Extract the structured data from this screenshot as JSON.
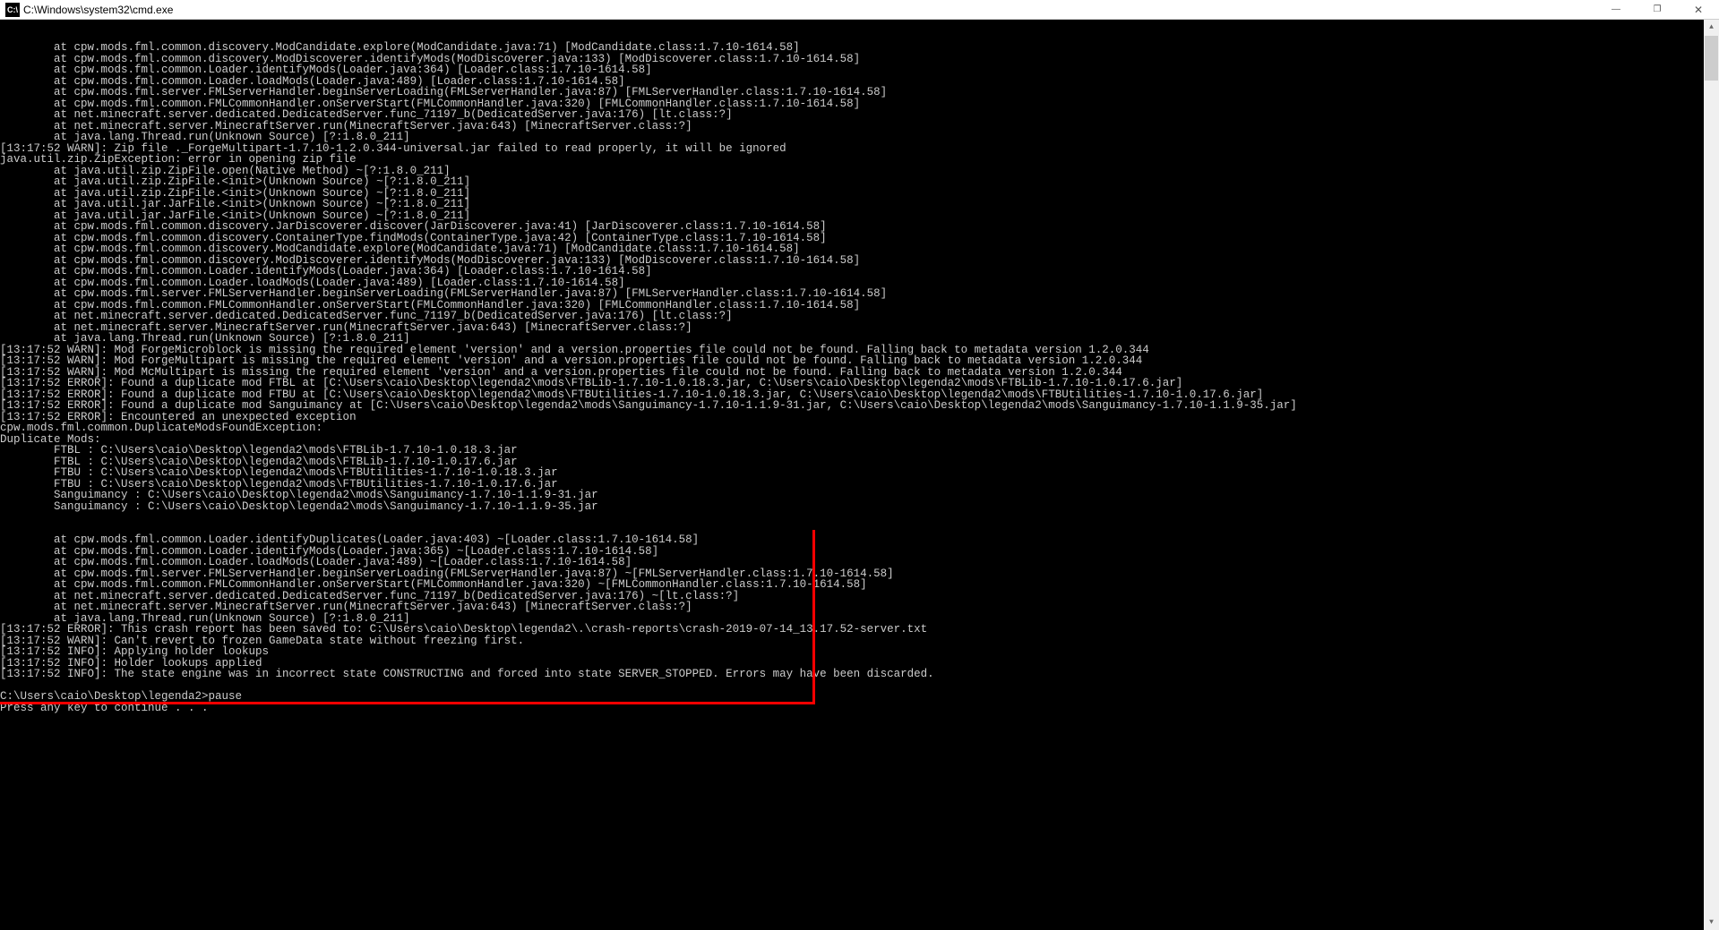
{
  "window": {
    "title": "C:\\Windows\\system32\\cmd.exe",
    "icon_label": "cmd-icon",
    "minimize": "—",
    "maximize": "❐",
    "close": "✕"
  },
  "terminal_lines": [
    "        at cpw.mods.fml.common.discovery.ModCandidate.explore(ModCandidate.java:71) [ModCandidate.class:1.7.10-1614.58]",
    "        at cpw.mods.fml.common.discovery.ModDiscoverer.identifyMods(ModDiscoverer.java:133) [ModDiscoverer.class:1.7.10-1614.58]",
    "        at cpw.mods.fml.common.Loader.identifyMods(Loader.java:364) [Loader.class:1.7.10-1614.58]",
    "        at cpw.mods.fml.common.Loader.loadMods(Loader.java:489) [Loader.class:1.7.10-1614.58]",
    "        at cpw.mods.fml.server.FMLServerHandler.beginServerLoading(FMLServerHandler.java:87) [FMLServerHandler.class:1.7.10-1614.58]",
    "        at cpw.mods.fml.common.FMLCommonHandler.onServerStart(FMLCommonHandler.java:320) [FMLCommonHandler.class:1.7.10-1614.58]",
    "        at net.minecraft.server.dedicated.DedicatedServer.func_71197_b(DedicatedServer.java:176) [lt.class:?]",
    "        at net.minecraft.server.MinecraftServer.run(MinecraftServer.java:643) [MinecraftServer.class:?]",
    "        at java.lang.Thread.run(Unknown Source) [?:1.8.0_211]",
    "[13:17:52 WARN]: Zip file ._ForgeMultipart-1.7.10-1.2.0.344-universal.jar failed to read properly, it will be ignored",
    "java.util.zip.ZipException: error in opening zip file",
    "        at java.util.zip.ZipFile.open(Native Method) ~[?:1.8.0_211]",
    "        at java.util.zip.ZipFile.<init>(Unknown Source) ~[?:1.8.0_211]",
    "        at java.util.zip.ZipFile.<init>(Unknown Source) ~[?:1.8.0_211]",
    "        at java.util.jar.JarFile.<init>(Unknown Source) ~[?:1.8.0_211]",
    "        at java.util.jar.JarFile.<init>(Unknown Source) ~[?:1.8.0_211]",
    "        at cpw.mods.fml.common.discovery.JarDiscoverer.discover(JarDiscoverer.java:41) [JarDiscoverer.class:1.7.10-1614.58]",
    "        at cpw.mods.fml.common.discovery.ContainerType.findMods(ContainerType.java:42) [ContainerType.class:1.7.10-1614.58]",
    "        at cpw.mods.fml.common.discovery.ModCandidate.explore(ModCandidate.java:71) [ModCandidate.class:1.7.10-1614.58]",
    "        at cpw.mods.fml.common.discovery.ModDiscoverer.identifyMods(ModDiscoverer.java:133) [ModDiscoverer.class:1.7.10-1614.58]",
    "        at cpw.mods.fml.common.Loader.identifyMods(Loader.java:364) [Loader.class:1.7.10-1614.58]",
    "        at cpw.mods.fml.common.Loader.loadMods(Loader.java:489) [Loader.class:1.7.10-1614.58]",
    "        at cpw.mods.fml.server.FMLServerHandler.beginServerLoading(FMLServerHandler.java:87) [FMLServerHandler.class:1.7.10-1614.58]",
    "        at cpw.mods.fml.common.FMLCommonHandler.onServerStart(FMLCommonHandler.java:320) [FMLCommonHandler.class:1.7.10-1614.58]",
    "        at net.minecraft.server.dedicated.DedicatedServer.func_71197_b(DedicatedServer.java:176) [lt.class:?]",
    "        at net.minecraft.server.MinecraftServer.run(MinecraftServer.java:643) [MinecraftServer.class:?]",
    "        at java.lang.Thread.run(Unknown Source) [?:1.8.0_211]",
    "[13:17:52 WARN]: Mod ForgeMicroblock is missing the required element 'version' and a version.properties file could not be found. Falling back to metadata version 1.2.0.344",
    "[13:17:52 WARN]: Mod ForgeMultipart is missing the required element 'version' and a version.properties file could not be found. Falling back to metadata version 1.2.0.344",
    "[13:17:52 WARN]: Mod McMultipart is missing the required element 'version' and a version.properties file could not be found. Falling back to metadata version 1.2.0.344",
    "[13:17:52 ERROR]: Found a duplicate mod FTBL at [C:\\Users\\caio\\Desktop\\legenda2\\mods\\FTBLib-1.7.10-1.0.18.3.jar, C:\\Users\\caio\\Desktop\\legenda2\\mods\\FTBLib-1.7.10-1.0.17.6.jar]",
    "[13:17:52 ERROR]: Found a duplicate mod FTBU at [C:\\Users\\caio\\Desktop\\legenda2\\mods\\FTBUtilities-1.7.10-1.0.18.3.jar, C:\\Users\\caio\\Desktop\\legenda2\\mods\\FTBUtilities-1.7.10-1.0.17.6.jar]",
    "[13:17:52 ERROR]: Found a duplicate mod Sanguimancy at [C:\\Users\\caio\\Desktop\\legenda2\\mods\\Sanguimancy-1.7.10-1.1.9-31.jar, C:\\Users\\caio\\Desktop\\legenda2\\mods\\Sanguimancy-1.7.10-1.1.9-35.jar]",
    "[13:17:52 ERROR]: Encountered an unexpected exception",
    "cpw.mods.fml.common.DuplicateModsFoundException: ",
    "Duplicate Mods:",
    "        FTBL : C:\\Users\\caio\\Desktop\\legenda2\\mods\\FTBLib-1.7.10-1.0.18.3.jar",
    "        FTBL : C:\\Users\\caio\\Desktop\\legenda2\\mods\\FTBLib-1.7.10-1.0.17.6.jar",
    "        FTBU : C:\\Users\\caio\\Desktop\\legenda2\\mods\\FTBUtilities-1.7.10-1.0.18.3.jar",
    "        FTBU : C:\\Users\\caio\\Desktop\\legenda2\\mods\\FTBUtilities-1.7.10-1.0.17.6.jar",
    "        Sanguimancy : C:\\Users\\caio\\Desktop\\legenda2\\mods\\Sanguimancy-1.7.10-1.1.9-31.jar",
    "        Sanguimancy : C:\\Users\\caio\\Desktop\\legenda2\\mods\\Sanguimancy-1.7.10-1.1.9-35.jar",
    "",
    "",
    "        at cpw.mods.fml.common.Loader.identifyDuplicates(Loader.java:403) ~[Loader.class:1.7.10-1614.58]",
    "        at cpw.mods.fml.common.Loader.identifyMods(Loader.java:365) ~[Loader.class:1.7.10-1614.58]",
    "        at cpw.mods.fml.common.Loader.loadMods(Loader.java:489) ~[Loader.class:1.7.10-1614.58]",
    "        at cpw.mods.fml.server.FMLServerHandler.beginServerLoading(FMLServerHandler.java:87) ~[FMLServerHandler.class:1.7.10-1614.58]",
    "        at cpw.mods.fml.common.FMLCommonHandler.onServerStart(FMLCommonHandler.java:320) ~[FMLCommonHandler.class:1.7.10-1614.58]",
    "        at net.minecraft.server.dedicated.DedicatedServer.func_71197_b(DedicatedServer.java:176) ~[lt.class:?]",
    "        at net.minecraft.server.MinecraftServer.run(MinecraftServer.java:643) [MinecraftServer.class:?]",
    "        at java.lang.Thread.run(Unknown Source) [?:1.8.0_211]",
    "[13:17:52 ERROR]: This crash report has been saved to: C:\\Users\\caio\\Desktop\\legenda2\\.\\crash-reports\\crash-2019-07-14_13.17.52-server.txt",
    "[13:17:52 WARN]: Can't revert to frozen GameData state without freezing first.",
    "[13:17:52 INFO]: Applying holder lookups",
    "[13:17:52 INFO]: Holder lookups applied",
    "[13:17:52 INFO]: The state engine was in incorrect state CONSTRUCTING and forced into state SERVER_STOPPED. Errors may have been discarded.",
    "",
    "C:\\Users\\caio\\Desktop\\legenda2>pause",
    "Press any key to continue . . ."
  ],
  "scrollbar": {
    "up": "▲",
    "down": "▼"
  }
}
